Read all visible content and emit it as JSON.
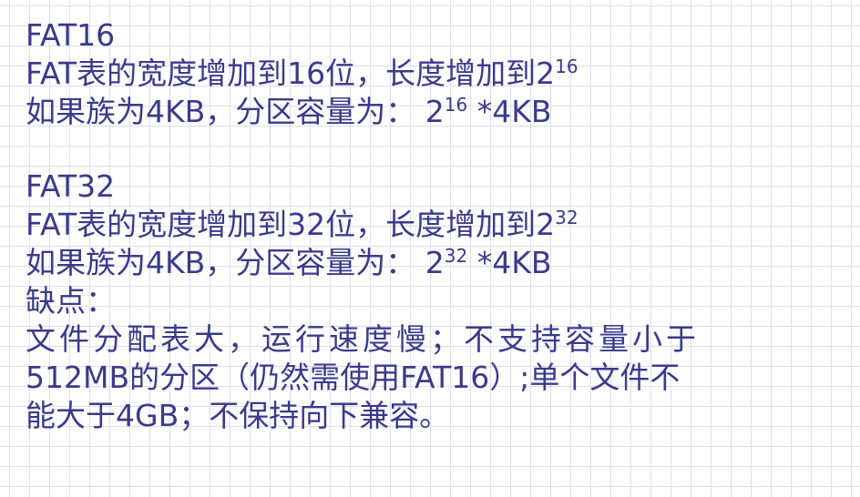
{
  "colors": {
    "text": "#3a3a8c",
    "grid": "#dcdcee",
    "background": "#ffffff"
  },
  "fat16": {
    "heading": "FAT16",
    "width_line_text": "FAT表的宽度增加到16位，长度增加到2",
    "width_line_exp": "16",
    "capacity_prefix": "如果族为4KB，分区容量为： 2",
    "capacity_exp": "16",
    "capacity_suffix": " *4KB"
  },
  "fat32": {
    "heading": "FAT32",
    "width_line_text": "FAT表的宽度增加到32位，长度增加到2",
    "width_line_exp": "32",
    "capacity_prefix": "如果族为4KB，分区容量为： 2",
    "capacity_exp": "32",
    "capacity_suffix": " *4KB",
    "drawbacks_label": "缺点：",
    "drawbacks_line1": "文件分配表大，运行速度慢；不支持容量小于",
    "drawbacks_line2": "512MB的分区（仍然需使用FAT16）;单个文件不",
    "drawbacks_line3": "能大于4GB；不保持向下兼容。"
  }
}
